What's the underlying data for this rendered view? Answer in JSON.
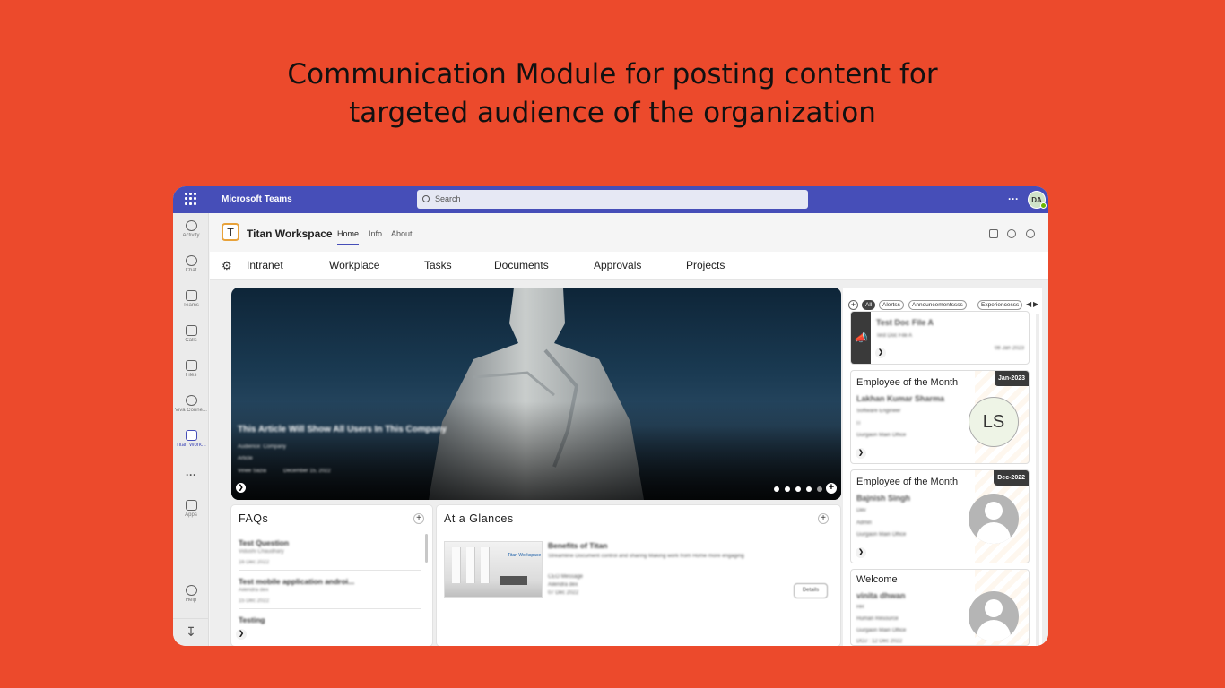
{
  "headline": {
    "line1": "Communication Module for posting content for",
    "line2": "targeted audience of the organization"
  },
  "teams": {
    "brand": "Microsoft Teams",
    "search_placeholder": "Search",
    "more": "···",
    "avatar_initials": "DA"
  },
  "rail": [
    {
      "label": "Activity",
      "icon": "bell-icon"
    },
    {
      "label": "Chat",
      "icon": "chat-icon"
    },
    {
      "label": "Teams",
      "icon": "teams-icon"
    },
    {
      "label": "Calls",
      "icon": "phone-icon"
    },
    {
      "label": "Files",
      "icon": "file-icon"
    },
    {
      "label": "Viva Conne...",
      "icon": "viva-connections-icon"
    },
    {
      "label": "Titan Work...",
      "icon": "titan-app-icon"
    },
    {
      "label": "Apps",
      "icon": "apps-icon"
    },
    {
      "label": "Help",
      "icon": "help-icon"
    }
  ],
  "rail_more": "···",
  "app": {
    "logo_letter": "T",
    "name": "Titan Workspace",
    "tabs": [
      "Home",
      "Info",
      "About"
    ]
  },
  "nav": [
    "Intranet",
    "Workplace",
    "Tasks",
    "Documents",
    "Approvals",
    "Projects"
  ],
  "hero": {
    "title": "This Article Will Show All Users In This Company",
    "audience": "Audience: Company",
    "type": "Article",
    "author": "Vinee Sazia",
    "date": "December 15, 2022"
  },
  "faqs": {
    "title": "FAQs",
    "items": [
      {
        "question": "Test Question",
        "author": "Vidushi Chaudhary",
        "date": "16 Dec 2022"
      },
      {
        "question": "Test mobile application androi...",
        "author": "Ailendra dex",
        "date": "15 Dec 2022"
      },
      {
        "question": "Testing",
        "author": "",
        "date": ""
      }
    ]
  },
  "glances": {
    "title": "At a Glances",
    "item": {
      "title": "Benefits of Titan",
      "description": "Streamline Document control and sharing Making work from Home more engaging",
      "category": "CEO Message",
      "author": "Ailendra dex",
      "date": "07 Dec 2022",
      "button": "Details",
      "image_sign": "Titan Workspace"
    }
  },
  "sidebar": {
    "filters": [
      "All",
      "Alertss",
      "Announcementssss",
      "Experiencesss"
    ],
    "announcement": {
      "title": "Test Doc File A",
      "subtitle": "Test Doc File A",
      "date": "08 Jan 2023"
    },
    "employee1": {
      "heading": "Employee of the Month",
      "badge": "Jan-2023",
      "name": "Lakhan Kumar Sharma",
      "role": "Software Engineer",
      "dept": "IT",
      "office": "Gurgaon Main Office",
      "initials": "LS"
    },
    "employee2": {
      "heading": "Employee of the Month",
      "badge": "Dec-2022",
      "name": "Bajnish Singh",
      "role": "Dev",
      "dept": "Admin",
      "office": "Gurgaon Main Office"
    },
    "welcome": {
      "heading": "Welcome",
      "name": "vinita dhwan",
      "role": "HR",
      "dept": "Human Resource",
      "office": "Gurgaon Main Office",
      "doj": "DOJ : 12 Dec 2022"
    }
  },
  "colors": {
    "background": "#EC4A2C",
    "teams_bar": "#464EB8",
    "badge": "#3A3A3A"
  }
}
